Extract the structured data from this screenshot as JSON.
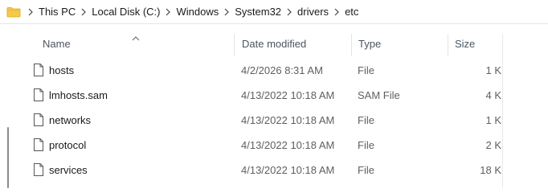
{
  "breadcrumb": {
    "items": [
      {
        "label": "This PC"
      },
      {
        "label": "Local Disk (C:)"
      },
      {
        "label": "Windows"
      },
      {
        "label": "System32"
      },
      {
        "label": "drivers"
      },
      {
        "label": "etc"
      }
    ]
  },
  "columns": {
    "name": "Name",
    "date_modified": "Date modified",
    "type": "Type",
    "size": "Size"
  },
  "files": [
    {
      "name": "hosts",
      "date_modified": "4/2/2026 8:31 AM",
      "type": "File",
      "size": "1 K"
    },
    {
      "name": "lmhosts.sam",
      "date_modified": "4/13/2022 10:18 AM",
      "type": "SAM File",
      "size": "4 K"
    },
    {
      "name": "networks",
      "date_modified": "4/13/2022 10:18 AM",
      "type": "File",
      "size": "1 K"
    },
    {
      "name": "protocol",
      "date_modified": "4/13/2022 10:18 AM",
      "type": "File",
      "size": "2 K"
    },
    {
      "name": "services",
      "date_modified": "4/13/2022 10:18 AM",
      "type": "File",
      "size": "18 K"
    }
  ],
  "icons": {
    "address_folder": "folder-icon",
    "separator": "chevron-right-icon",
    "sort": "chevron-up-icon",
    "file": "file-icon"
  },
  "colors": {
    "folder_yellow": "#f7c948",
    "header_text": "#4a5561",
    "secondary_text": "#5f5f5f"
  }
}
